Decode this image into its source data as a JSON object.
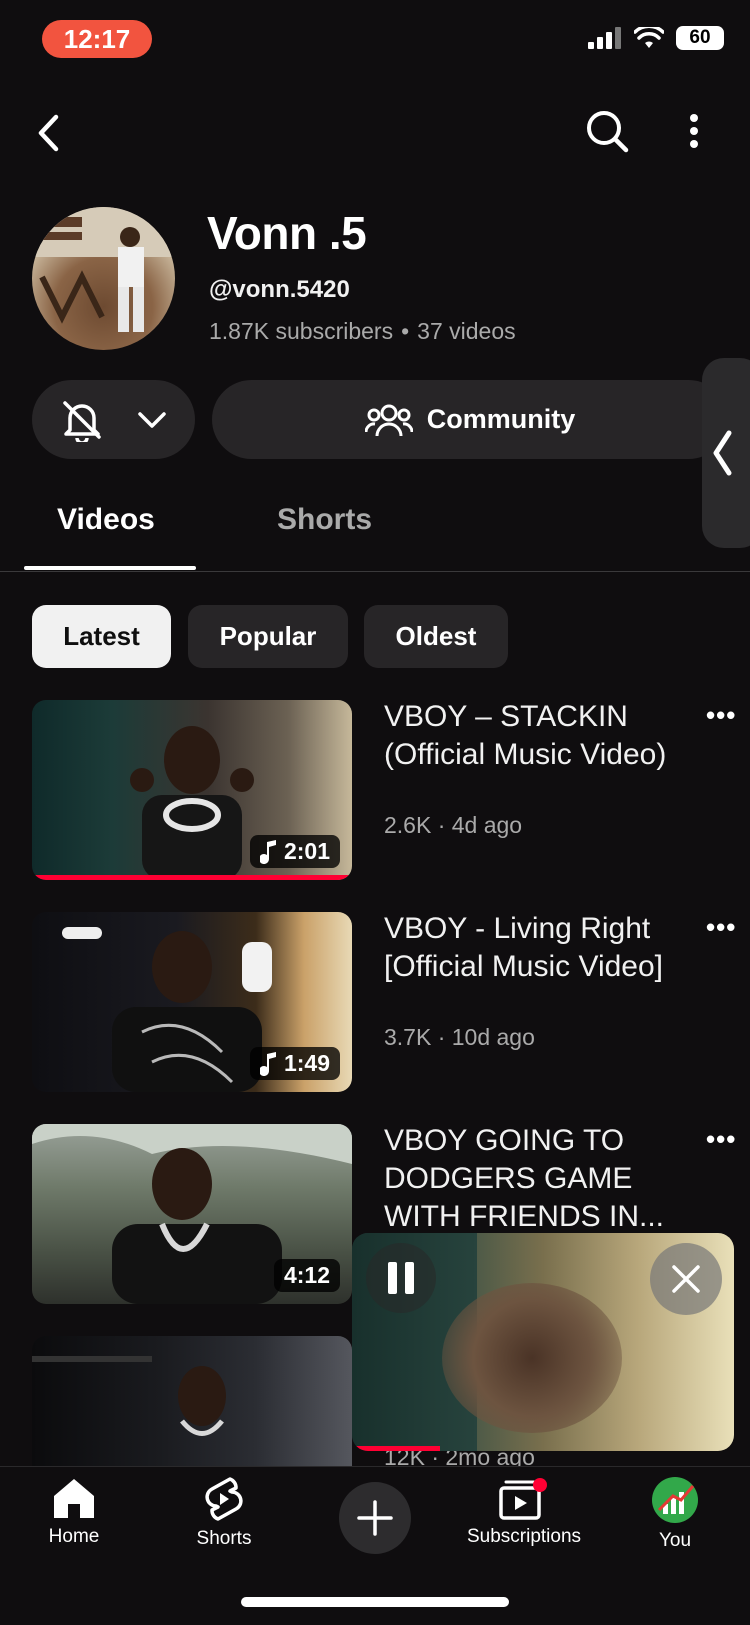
{
  "status_bar": {
    "time": "12:17",
    "battery": "60"
  },
  "channel": {
    "name": "Vonn .5",
    "handle": "@vonn.5420",
    "subscribers": "1.87K subscribers",
    "separator": "•",
    "video_count": "37 videos"
  },
  "actions": {
    "community_label": "Community"
  },
  "tabs": [
    {
      "label": "Videos",
      "active": true
    },
    {
      "label": "Shorts",
      "active": false
    }
  ],
  "chips": [
    {
      "label": "Latest",
      "active": true
    },
    {
      "label": "Popular",
      "active": false
    },
    {
      "label": "Oldest",
      "active": false
    }
  ],
  "videos": [
    {
      "title": "VBOY – STACKIN (Official Music Video)",
      "meta": "2.6K · 4d ago",
      "duration": "2:01",
      "music": true,
      "watched_fraction": 1.0
    },
    {
      "title": "VBOY - Living Right [Official Music Video]",
      "meta": "3.7K · 10d ago",
      "duration": "1:49",
      "music": true
    },
    {
      "title": "VBOY GOING TO DODGERS GAME WITH FRIENDS IN...",
      "duration": "4:12",
      "music": false
    },
    {
      "meta": "12K · 2mo ago"
    }
  ],
  "more_glyph": "•••",
  "mini_player": {
    "progress_fraction": 0.23
  },
  "bottom_nav": [
    {
      "label": "Home",
      "icon": "home-icon"
    },
    {
      "label": "Shorts",
      "icon": "shorts-icon"
    },
    {
      "label": "",
      "icon": "plus-icon"
    },
    {
      "label": "Subscriptions",
      "icon": "subscriptions-icon"
    },
    {
      "label": "You",
      "icon": "avatar"
    }
  ],
  "colors": {
    "background": "#0f0d0f",
    "accent_red": "#ff0033",
    "time_pill": "#f2543f"
  }
}
